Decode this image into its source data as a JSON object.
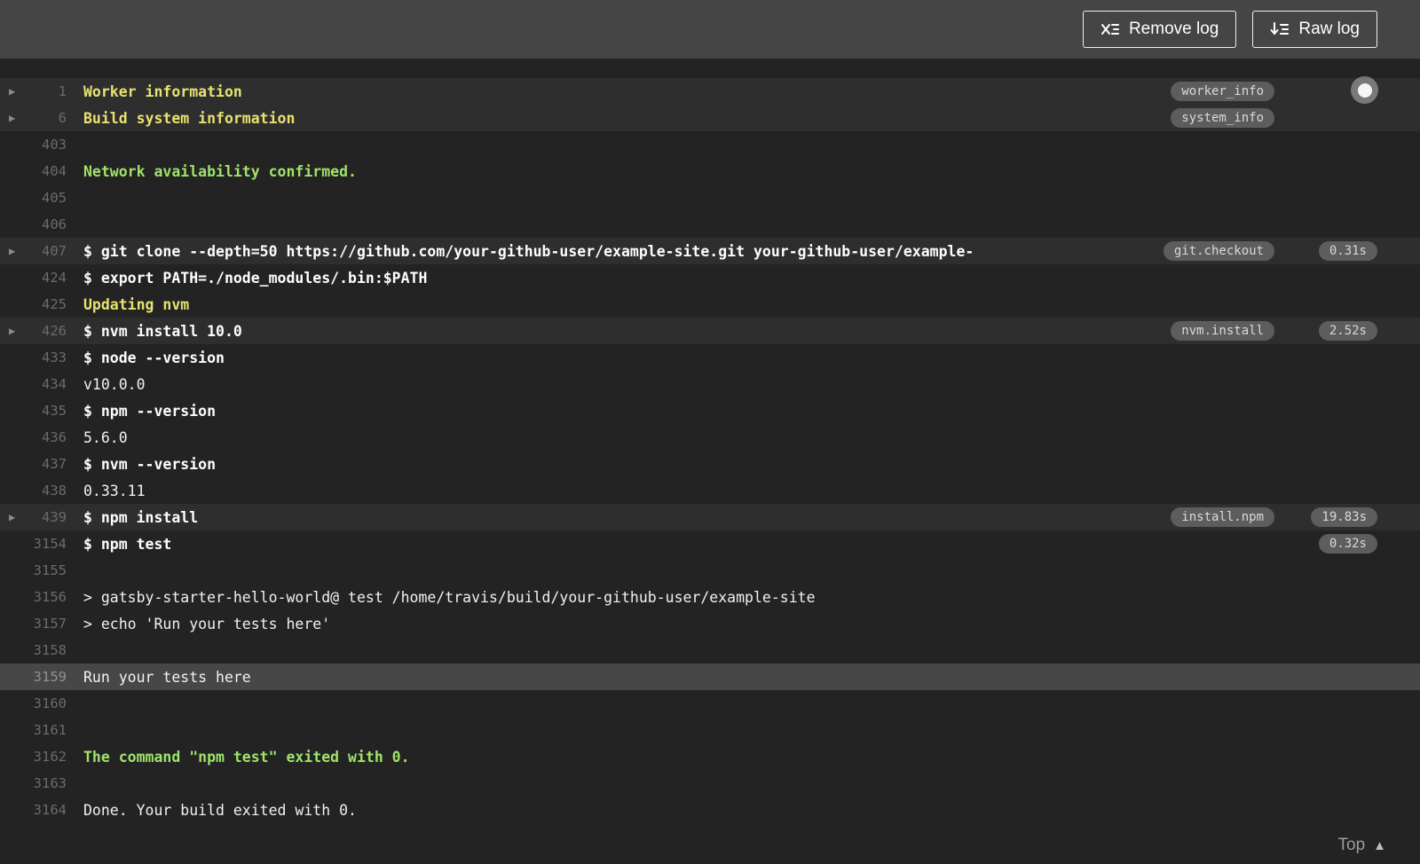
{
  "header": {
    "remove_log_label": "Remove log",
    "raw_log_label": "Raw log"
  },
  "footer": {
    "top_label": "Top"
  },
  "icons": {
    "fold_arrow": "▶",
    "top_arrow": "▲",
    "remove_log_icon": "x-with-list-lines",
    "raw_log_icon": "down-arrow-with-list-lines"
  },
  "colors": {
    "background": "#232323",
    "header_bg": "#454545",
    "fold_row_bg": "#2e2e2e",
    "highlight_row_bg": "#474747",
    "text": "#f1f1f1",
    "line_number": "#6b6b6b",
    "yellow": "#e8e26f",
    "green": "#9fe36a",
    "pill_bg": "#5d5d5d",
    "pill_text": "#d9d9d9"
  },
  "log": {
    "rows": [
      {
        "num": "1",
        "text": "Worker information",
        "style": "header",
        "fold": true,
        "foldRow": true,
        "tag": "worker_info"
      },
      {
        "num": "6",
        "text": "Build system information",
        "style": "header",
        "fold": true,
        "foldRow": true,
        "tag": "system_info"
      },
      {
        "num": "403",
        "text": ""
      },
      {
        "num": "404",
        "text": "Network availability confirmed.",
        "style": "success"
      },
      {
        "num": "405",
        "text": ""
      },
      {
        "num": "406",
        "text": ""
      },
      {
        "num": "407",
        "text": "$ git clone --depth=50 https://github.com/your-github-user/example-site.git your-github-user/example-",
        "style": "command",
        "fold": true,
        "foldRow": true,
        "tag": "git.checkout",
        "duration": "0.31s"
      },
      {
        "num": "424",
        "text": "$ export PATH=./node_modules/.bin:$PATH",
        "style": "command"
      },
      {
        "num": "425",
        "text": "Updating nvm",
        "style": "header"
      },
      {
        "num": "426",
        "text": "$ nvm install 10.0",
        "style": "command",
        "fold": true,
        "foldRow": true,
        "tag": "nvm.install",
        "duration": "2.52s"
      },
      {
        "num": "433",
        "text": "$ node --version",
        "style": "command"
      },
      {
        "num": "434",
        "text": "v10.0.0"
      },
      {
        "num": "435",
        "text": "$ npm --version",
        "style": "command"
      },
      {
        "num": "436",
        "text": "5.6.0"
      },
      {
        "num": "437",
        "text": "$ nvm --version",
        "style": "command"
      },
      {
        "num": "438",
        "text": "0.33.11"
      },
      {
        "num": "439",
        "text": "$ npm install",
        "style": "command",
        "fold": true,
        "foldRow": true,
        "tag": "install.npm",
        "duration": "19.83s"
      },
      {
        "num": "3154",
        "text": "$ npm test",
        "style": "command",
        "duration": "0.32s"
      },
      {
        "num": "3155",
        "text": ""
      },
      {
        "num": "3156",
        "text": "> gatsby-starter-hello-world@ test /home/travis/build/your-github-user/example-site"
      },
      {
        "num": "3157",
        "text": "> echo 'Run your tests here'"
      },
      {
        "num": "3158",
        "text": ""
      },
      {
        "num": "3159",
        "text": "Run your tests here",
        "highlight": true
      },
      {
        "num": "3160",
        "text": ""
      },
      {
        "num": "3161",
        "text": ""
      },
      {
        "num": "3162",
        "text": "The command \"npm test\" exited with 0.",
        "style": "success"
      },
      {
        "num": "3163",
        "text": ""
      },
      {
        "num": "3164",
        "text": "Done. Your build exited with 0."
      }
    ]
  }
}
